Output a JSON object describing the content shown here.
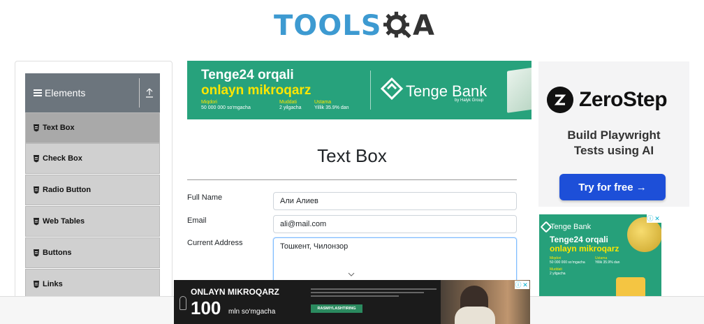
{
  "logo": {
    "part1": "TOOLS",
    "part2": "A"
  },
  "sidebar": {
    "group_label": "Elements",
    "items": [
      {
        "label": "Text Box",
        "active": true
      },
      {
        "label": "Check Box",
        "active": false
      },
      {
        "label": "Radio Button",
        "active": false
      },
      {
        "label": "Web Tables",
        "active": false
      },
      {
        "label": "Buttons",
        "active": false
      },
      {
        "label": "Links",
        "active": false
      }
    ]
  },
  "top_ad": {
    "headline1": "Tenge24 orqali",
    "headline2": "onlayn mikroqarz",
    "col1_label": "Miqdori",
    "col1_value": "50 000 000 so‘mgacha",
    "col2_label": "Muddati",
    "col2_value": "2 yilgacha",
    "col3_label": "Ustama",
    "col3_value": "Yillik 35.9% dan",
    "brand": "Tenge Bank",
    "brand_sub": "by Halyk Group"
  },
  "form": {
    "title": "Text Box",
    "full_name_label": "Full Name",
    "full_name_value": "Али Алиев",
    "email_label": "Email",
    "email_value": "ali@mail.com",
    "address_label": "Current Address",
    "address_value": "Тошкент, Чилонзор"
  },
  "right_ad": {
    "brand": "ZeroStep",
    "tagline1": "Build Playwright",
    "tagline2": "Tests using AI",
    "cta": "Try for free →"
  },
  "right_ad2": {
    "brand": "Tenge Bank",
    "headline1": "Tenge24 orqali",
    "headline2": "onlayn mikroqarz",
    "col1_label": "Miqdori",
    "col1_value": "50 000 000 so‘mgacha",
    "col2_label": "Ustama",
    "col2_value": "Yillik 35.9% dan",
    "col3_label": "Muddati",
    "col3_value": "2 yilgacha"
  },
  "bottom_ad": {
    "line1": "ONLAYN MIKROQARZ",
    "amount": "100",
    "amount_unit": "mln so‘mgacha",
    "cta": "RASMIYLASHTIRING"
  },
  "colors": {
    "accent_blue": "#3d9ad1",
    "sidebar_header": "#6c757d",
    "bank_green": "#27a27c",
    "zerostep_blue": "#1d4fd8"
  }
}
